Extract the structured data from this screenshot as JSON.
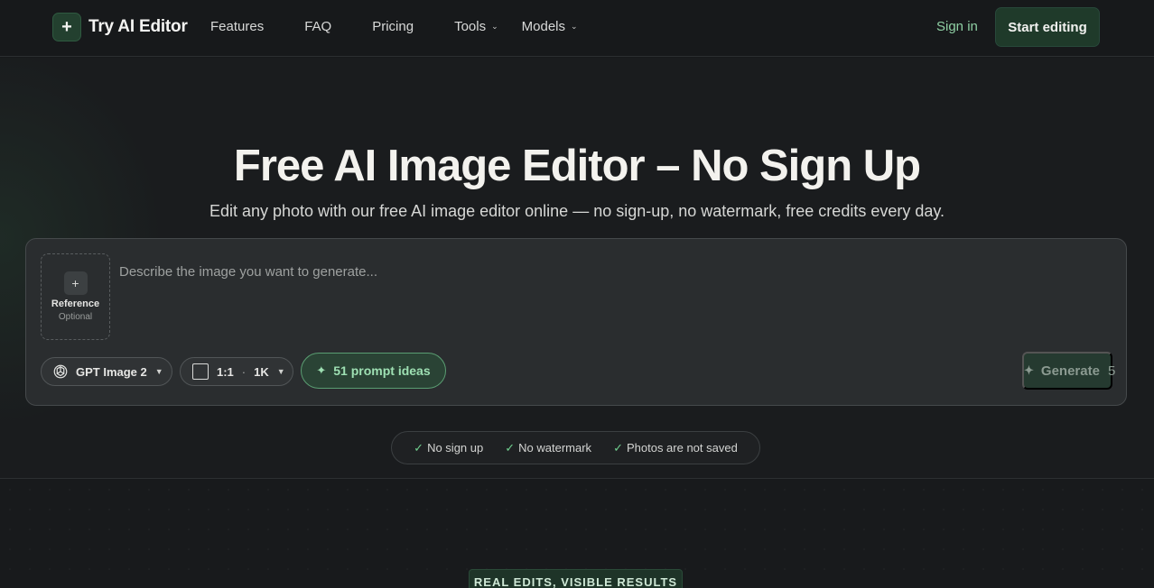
{
  "header": {
    "logo_text": "Try AI Editor",
    "logo_icon": "sparkle-icon",
    "nav": [
      {
        "label": "Features"
      },
      {
        "label": "FAQ"
      },
      {
        "label": "Pricing"
      },
      {
        "label": "Tools"
      },
      {
        "label": "Models"
      }
    ],
    "sign_in": "Sign in",
    "start_editing": "Start editing"
  },
  "hero": {
    "title": "Free AI Image Editor – No Sign Up",
    "subtitle": "Edit any photo with our free AI image editor online — no sign-up, no watermark, free credits every day."
  },
  "editor": {
    "reference_label": "Reference",
    "reference_sub": "Optional",
    "prompt_placeholder": "Describe the image you want to generate...",
    "model_label": "GPT Image 2",
    "aspect_ratio": "1:1",
    "resolution": "1K",
    "prompt_ideas": "51 prompt ideas",
    "generate_label": "Generate",
    "generate_cost": "5"
  },
  "badges": [
    {
      "label": "No sign up"
    },
    {
      "label": "No watermark"
    },
    {
      "label": "Photos are not saved"
    }
  ],
  "section2": {
    "eyebrow": "REAL EDITS, VISIBLE RESULTS"
  },
  "colors": {
    "accent": "#8fd0a4",
    "brand_dark": "#1f3a2a"
  }
}
